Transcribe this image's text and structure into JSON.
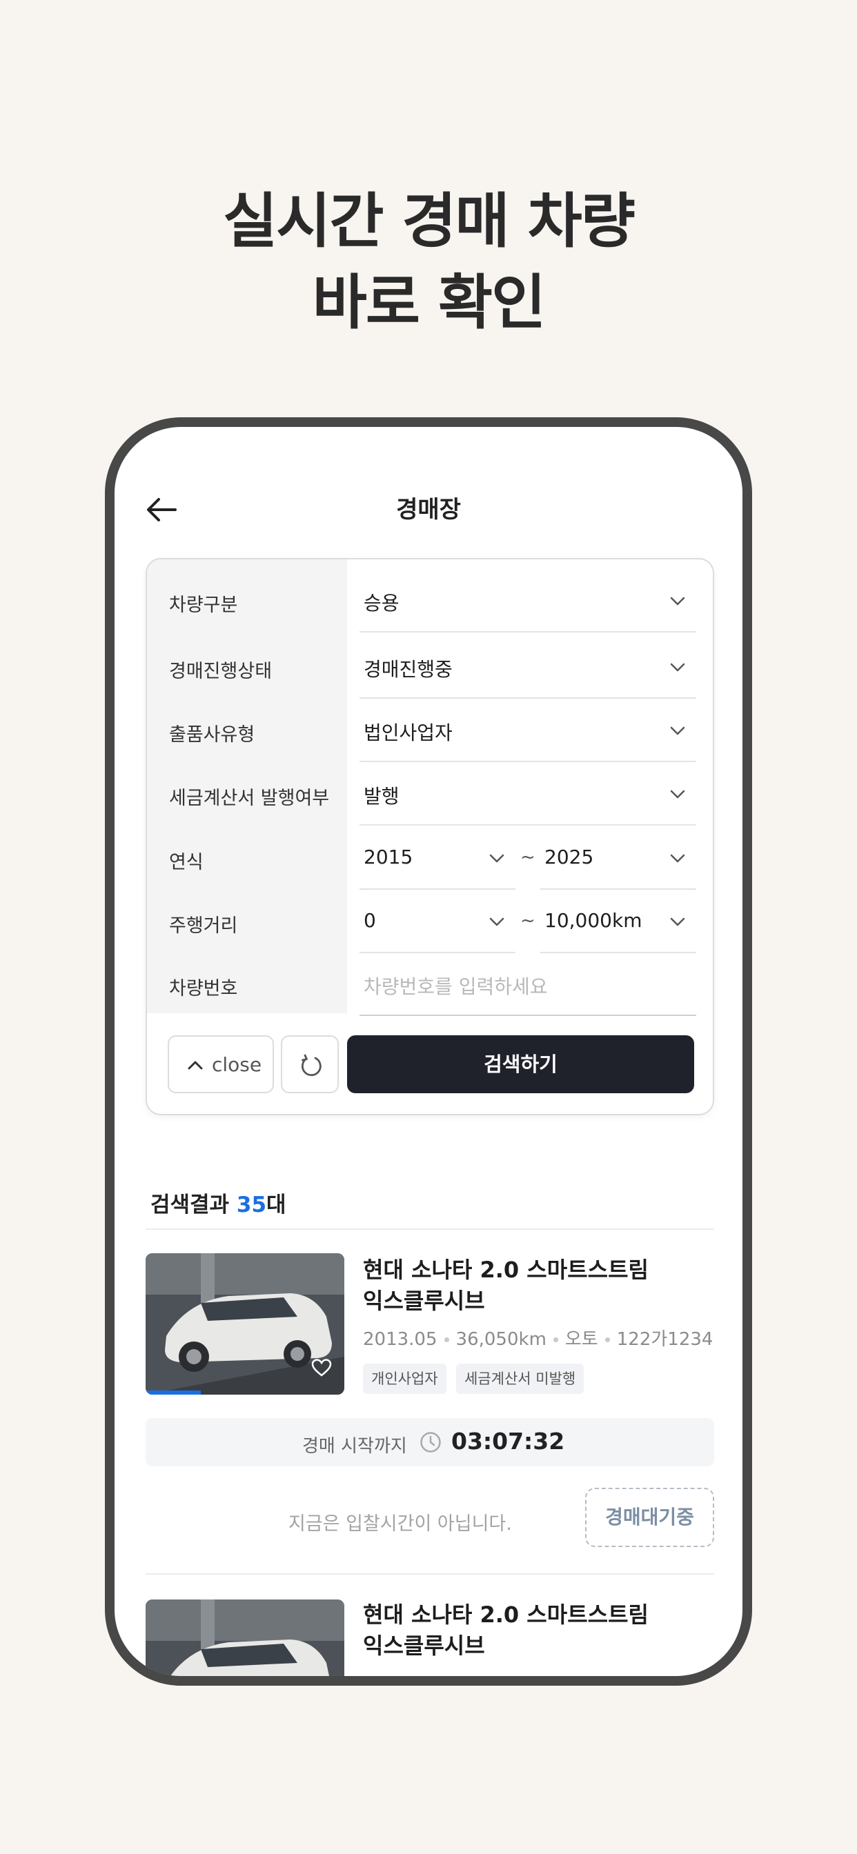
{
  "promo": {
    "line1": "실시간 경매 차량",
    "line2": "바로 확인"
  },
  "appbar": {
    "title": "경매장",
    "back_icon": "arrow-left-icon"
  },
  "filters": {
    "vehicle_type": {
      "label": "차량구분",
      "value": "승용"
    },
    "auction_status": {
      "label": "경매진행상태",
      "value": "경매진행중"
    },
    "seller_type": {
      "label": "출품사유형",
      "value": "법인사업자"
    },
    "tax_invoice": {
      "label": "세금계산서 발행여부",
      "value": "발행"
    },
    "year": {
      "label": "연식",
      "from": "2015",
      "to": "2025",
      "separator": "~"
    },
    "mileage": {
      "label": "주행거리",
      "from": "0",
      "to": "10,000km",
      "separator": "~"
    },
    "plate": {
      "label": "차량번호",
      "placeholder": "차량번호를 입력하세요"
    }
  },
  "actions": {
    "close_label": "close",
    "search_label": "검색하기",
    "reset_icon": "refresh-icon"
  },
  "results": {
    "prefix": "검색결과 ",
    "count": "35",
    "suffix": "대"
  },
  "cars": [
    {
      "title_line1": "현대 소나타 2.0 스마트스트림",
      "title_line2": "익스클루시브",
      "year": "2013.05",
      "mileage": "36,050km",
      "transmission": "오토",
      "plate": "122가1234",
      "tags": [
        "개인사업자",
        "세금계산서 미발행"
      ],
      "timer_label": "경매 시작까지",
      "timer_value": "03:07:32",
      "notice": "지금은 입찰시간이 아닙니다.",
      "status_button": "경매대기중"
    },
    {
      "title_line1": "현대 소나타 2.0 스마트스트림",
      "title_line2": "익스클루시브"
    }
  ],
  "colors": {
    "background": "#f8f4f0",
    "accent_blue": "#1a6fe0",
    "search_button": "#1f212b",
    "phone_frame": "#484848"
  }
}
